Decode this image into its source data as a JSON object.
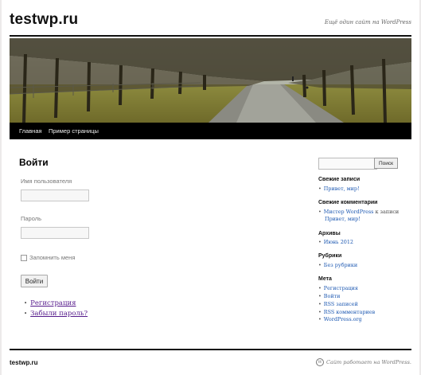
{
  "site": {
    "title": "testwp.ru",
    "tagline": "Ещё один сайт на WordPress"
  },
  "nav": {
    "items": [
      "Главная",
      "Пример страницы"
    ]
  },
  "login": {
    "heading": "Войти",
    "username_label": "Имя пользователя",
    "username_value": "",
    "password_label": "Пароль",
    "password_value": "",
    "remember_label": "Запомнить меня",
    "submit_label": "Войти",
    "links": [
      "Регистрация",
      "Забыли пароль?"
    ]
  },
  "sidebar": {
    "search_value": "",
    "search_button": "Поиск",
    "recent_posts_title": "Свежие записи",
    "recent_posts": [
      "Привет, мир!"
    ],
    "recent_comments_title": "Свежие комментарии",
    "recent_comment": {
      "author": "Мистер WordPress",
      "connector": "к записи",
      "post": "Привет, мир!"
    },
    "archives_title": "Архивы",
    "archives": [
      "Июнь 2012"
    ],
    "categories_title": "Рубрики",
    "categories": [
      "Без рубрики"
    ],
    "meta_title": "Мета",
    "meta": [
      "Регистрация",
      "Войти",
      "RSS записей",
      "RSS комментариев",
      "WordPress.org"
    ]
  },
  "footer": {
    "title": "testwp.ru",
    "powered": "Сайт работает на WordPress."
  },
  "colors": {
    "link": "#1b57b1",
    "visited_link": "#551a8b",
    "nav_background": "#000000",
    "rule": "#111111"
  }
}
